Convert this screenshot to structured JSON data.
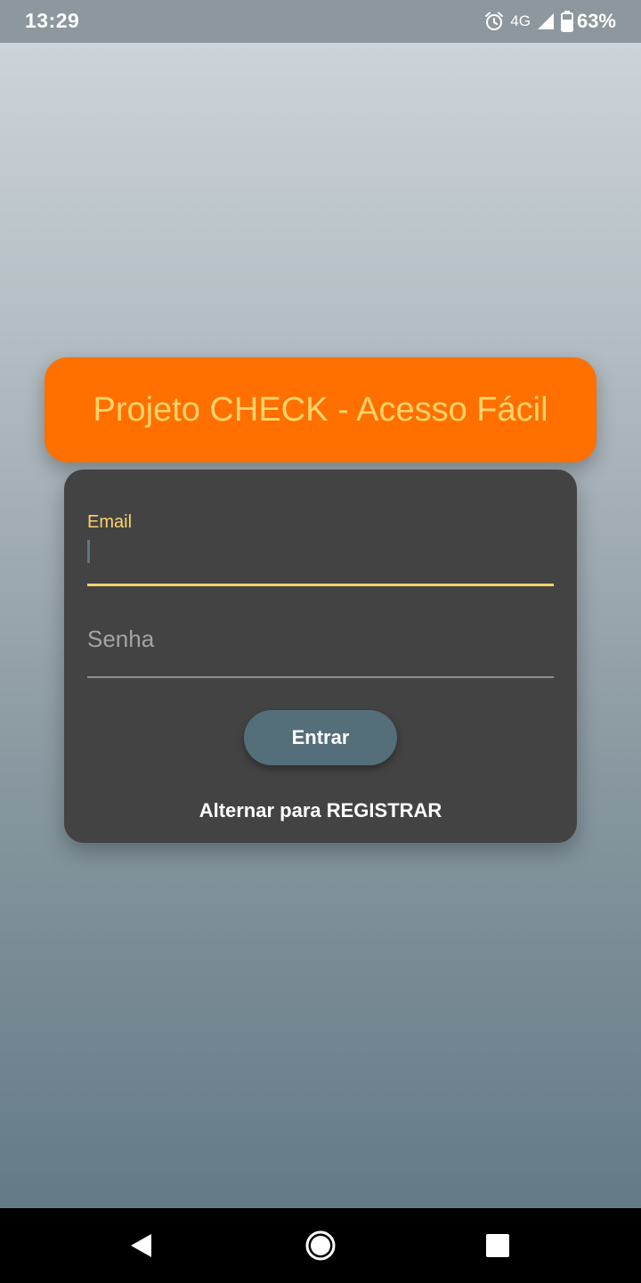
{
  "status_bar": {
    "time": "13:29",
    "network": "4G",
    "battery": "63%",
    "icons": [
      "alarm-icon",
      "signal-icon",
      "battery-icon"
    ]
  },
  "header": {
    "title": "Projeto CHECK - Acesso Fácil"
  },
  "form": {
    "email_label": "Email",
    "email_value": "",
    "password_placeholder": "Senha",
    "password_value": "",
    "submit_label": "Entrar",
    "toggle_label": "Alternar para REGISTRAR"
  },
  "nav_bar": {
    "icons": [
      "back-icon",
      "home-icon",
      "recents-icon"
    ]
  },
  "colors": {
    "header_bg": "#ff7000",
    "header_text": "#ffd36b",
    "card_bg": "#434343",
    "accent": "#fdd36a",
    "button_bg": "#546e7a"
  }
}
